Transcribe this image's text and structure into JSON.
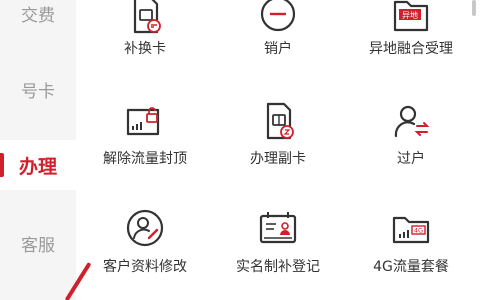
{
  "sidebar": {
    "items": [
      {
        "label": "交费"
      },
      {
        "label": "号卡"
      },
      {
        "label": "办理",
        "active": true
      },
      {
        "label": "客服"
      }
    ]
  },
  "services": [
    {
      "label": "补换卡",
      "icon": "sim-card-swap-icon"
    },
    {
      "label": "销户",
      "icon": "minus-circle-icon"
    },
    {
      "label": "异地融合受理",
      "icon": "remote-folder-icon",
      "badge": "异地"
    },
    {
      "label": "解除流量封顶",
      "icon": "unlock-traffic-card-icon"
    },
    {
      "label": "办理副卡",
      "icon": "secondary-sim-icon"
    },
    {
      "label": "过户",
      "icon": "user-transfer-icon"
    },
    {
      "label": "客户资料修改",
      "icon": "user-edit-icon"
    },
    {
      "label": "实名制补登记",
      "icon": "id-card-icon"
    },
    {
      "label": "4G流量套餐",
      "icon": "data-plan-folder-icon",
      "badge": "4G"
    }
  ],
  "colors": {
    "accent": "#d0202b",
    "icon_stroke": "#333333"
  }
}
